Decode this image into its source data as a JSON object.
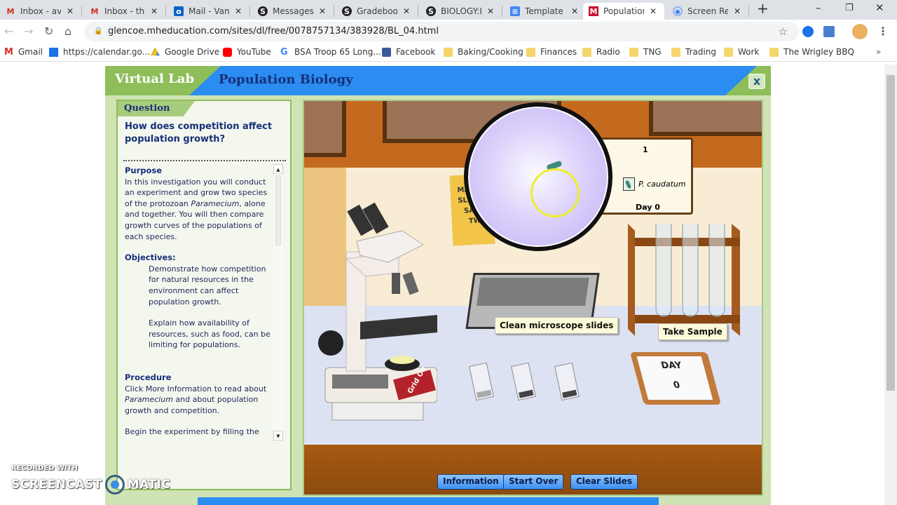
{
  "browser": {
    "tabs": [
      {
        "label": "Inbox - avd",
        "icon": "gmail-icon",
        "active": false
      },
      {
        "label": "Inbox - the",
        "icon": "gmail-icon",
        "active": false
      },
      {
        "label": "Mail - Van",
        "icon": "outlook-icon",
        "active": false
      },
      {
        "label": "Messages |",
        "icon": "schoology-icon",
        "active": false
      },
      {
        "label": "Gradebook",
        "icon": "schoology-icon",
        "active": false
      },
      {
        "label": "BIOLOGY:L",
        "icon": "schoology-icon",
        "active": false
      },
      {
        "label": "Template -",
        "icon": "docs-icon",
        "active": false
      },
      {
        "label": "Population",
        "icon": "mheducation-icon",
        "active": true
      },
      {
        "label": "Screen Rec",
        "icon": "screencast-icon",
        "active": false
      }
    ],
    "url": "glencoe.mheducation.com/sites/dl/free/0078757134/383928/BL_04.html",
    "bookmarks": [
      {
        "label": "Gmail",
        "icon": "gmail-icon"
      },
      {
        "label": "https://calendar.go...",
        "icon": "calendar-icon"
      },
      {
        "label": "Google Drive",
        "icon": "drive-icon"
      },
      {
        "label": "YouTube",
        "icon": "youtube-icon"
      },
      {
        "label": "BSA Troop 65 Long...",
        "icon": "google-icon"
      },
      {
        "label": "Facebook",
        "icon": "facebook-icon"
      },
      {
        "label": "Baking/Cooking",
        "icon": "folder-icon"
      },
      {
        "label": "Finances",
        "icon": "folder-icon"
      },
      {
        "label": "Radio",
        "icon": "folder-icon"
      },
      {
        "label": "TNG",
        "icon": "folder-icon"
      },
      {
        "label": "Trading",
        "icon": "folder-icon"
      },
      {
        "label": "Work",
        "icon": "folder-icon"
      },
      {
        "label": "The Wrigley BBQ",
        "icon": "folder-icon"
      }
    ],
    "more_bookmarks": "»"
  },
  "lab": {
    "brand": "Virtual Lab",
    "title": "Population Biology",
    "close_label": "x",
    "question_heading": "Question",
    "question": "How does competition affect population growth?",
    "purpose_heading": "Purpose",
    "purpose_text_1": "In this investigation you will conduct an experiment and grow two species of the protozoan ",
    "purpose_italic": "Paramecium",
    "purpose_text_2": ", alone and together. You will then compare growth curves of the populations of each species.",
    "objectives_heading": "Objectives:",
    "objective_1": "Demonstrate how competition for natural resources in the environment can affect population growth.",
    "objective_2": "Explain how availability of resources, such as food, can be limiting for populations.",
    "procedure_heading": "Procedure",
    "procedure_text_1": "Click More Information to read about ",
    "procedure_italic": "Paramecium",
    "procedure_text_2": " and about population growth and competition.",
    "procedure_text_3": "Begin the experiment by filling the",
    "note_lines": [
      "MA",
      "SLI",
      "SA",
      "TW"
    ],
    "sample_card": {
      "count": "1",
      "species": "P. caudatum",
      "day": "Day 0"
    },
    "slides_tooltip": "Clean microscope slides",
    "sample_tooltip": "Take Sample",
    "microscope_switch": "Grid On",
    "day_board": {
      "label": "DAY",
      "value": "0"
    },
    "buttons": {
      "information": "Information",
      "start_over": "Start Over",
      "clear_slides": "Clear Slides"
    }
  },
  "watermark": {
    "line1": "RECORDED WITH",
    "left": "SCREENCAST",
    "right": "MATIC"
  }
}
